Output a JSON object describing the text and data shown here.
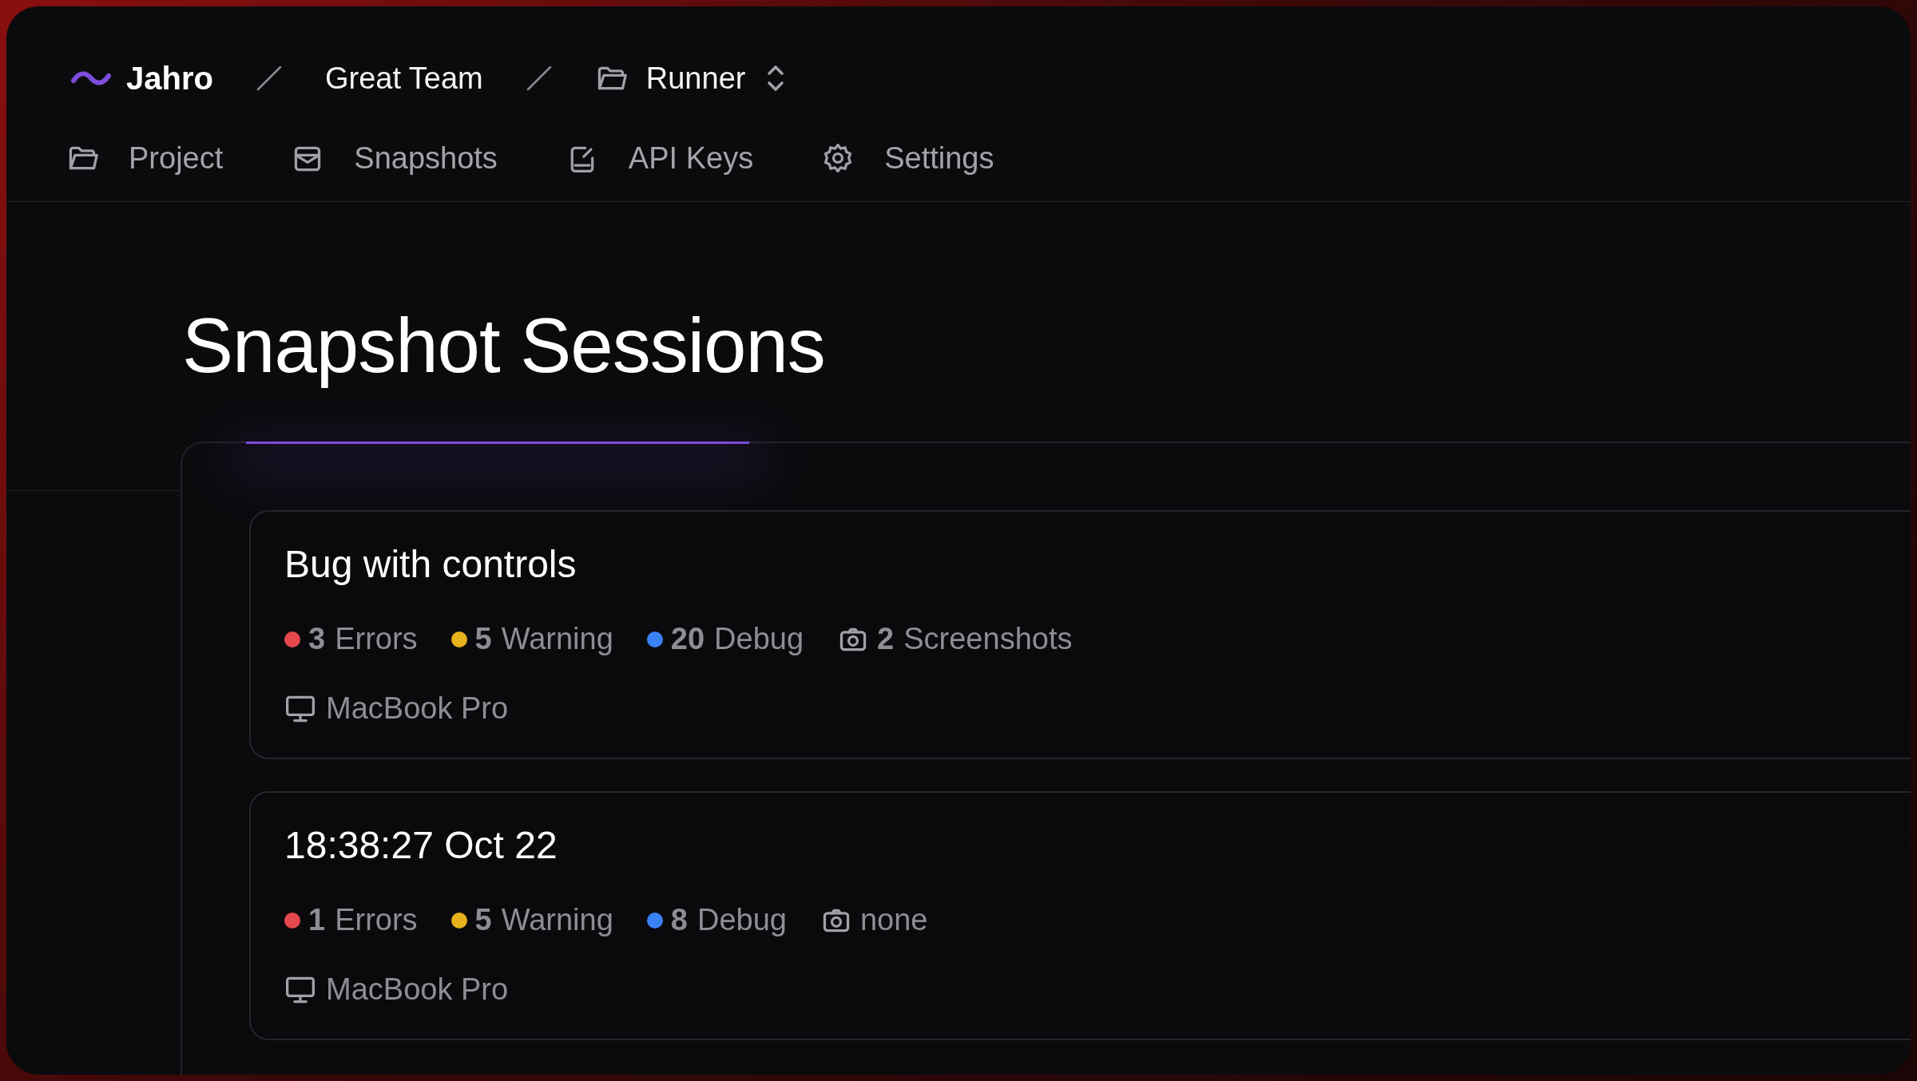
{
  "brand": {
    "name": "Jahro"
  },
  "breadcrumb": {
    "team": "Great Team",
    "project": "Runner"
  },
  "nav": [
    {
      "kind": "project",
      "label": "Project"
    },
    {
      "kind": "snapshots",
      "label": "Snapshots"
    },
    {
      "kind": "keys",
      "label": "API Keys"
    },
    {
      "kind": "settings",
      "label": "Settings"
    }
  ],
  "page_title": "Snapshot Sessions",
  "sessions": [
    {
      "title": "Bug with controls",
      "stats": [
        {
          "count": "3",
          "label": "Errors",
          "color": "#e5484d"
        },
        {
          "count": "5",
          "label": "Warning",
          "color": "#e5b21c"
        },
        {
          "count": "20",
          "label": "Debug",
          "color": "#3b82f6"
        }
      ],
      "screenshots": {
        "count": "2",
        "label": "Screenshots"
      },
      "device": "MacBook Pro"
    },
    {
      "title": "18:38:27 Oct 22",
      "stats": [
        {
          "count": "1",
          "label": "Errors",
          "color": "#e5484d"
        },
        {
          "count": "5",
          "label": "Warning",
          "color": "#e5b21c"
        },
        {
          "count": "8",
          "label": "Debug",
          "color": "#3b82f6"
        }
      ],
      "screenshots": {
        "label": "none"
      },
      "device": "MacBook Pro"
    }
  ]
}
